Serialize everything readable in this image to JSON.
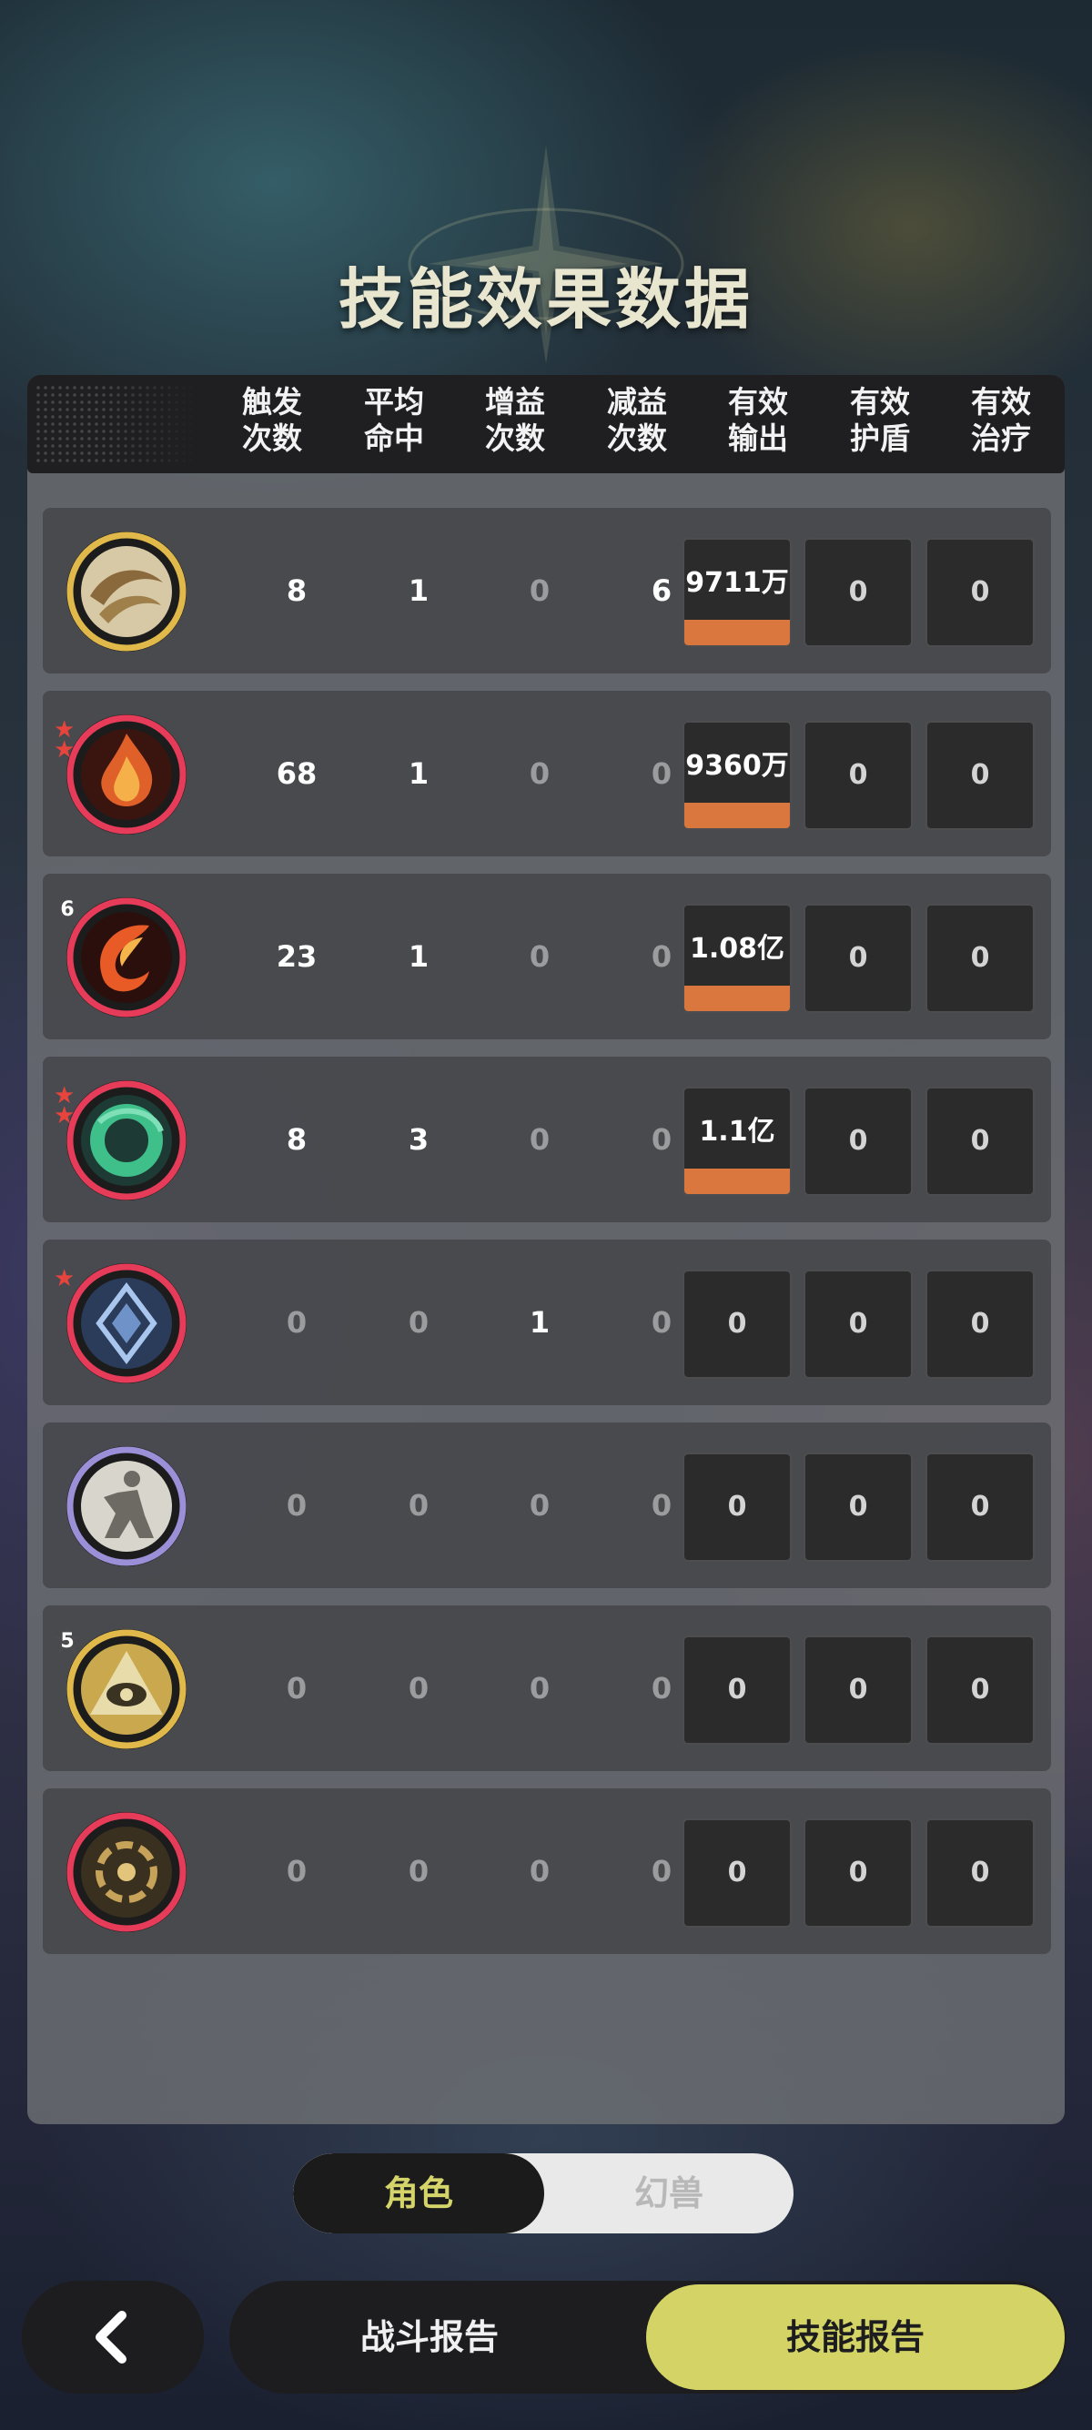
{
  "title": "技能效果数据",
  "columns": [
    {
      "line1": "触发",
      "line2": "次数"
    },
    {
      "line1": "平均",
      "line2": "命中"
    },
    {
      "line1": "增益",
      "line2": "次数"
    },
    {
      "line1": "减益",
      "line2": "次数"
    },
    {
      "line1": "有效",
      "line2": "输出"
    },
    {
      "line1": "有效",
      "line2": "护盾"
    },
    {
      "line1": "有效",
      "line2": "治疗"
    }
  ],
  "rows": [
    {
      "icon": "golden-wind-skill-icon",
      "ring": "#e0b94a",
      "badge": "",
      "trigger": "8",
      "avg_hit": "1",
      "buff": "0",
      "debuff": "6",
      "output": "9711万",
      "shield": "0",
      "heal": "0"
    },
    {
      "icon": "fire-burst-skill-icon",
      "ring": "#e63c5a",
      "badge": "stars-2",
      "trigger": "68",
      "avg_hit": "1",
      "buff": "0",
      "debuff": "0",
      "output": "9360万",
      "shield": "0",
      "heal": "0"
    },
    {
      "icon": "fire-swirl-skill-icon",
      "ring": "#e63c5a",
      "badge": "6",
      "trigger": "23",
      "avg_hit": "1",
      "buff": "0",
      "debuff": "0",
      "output": "1.08亿",
      "shield": "0",
      "heal": "0"
    },
    {
      "icon": "jade-ring-skill-icon",
      "ring": "#e63c5a",
      "badge": "stars-2",
      "trigger": "8",
      "avg_hit": "3",
      "buff": "0",
      "debuff": "0",
      "output": "1.1亿",
      "shield": "0",
      "heal": "0"
    },
    {
      "icon": "blue-sigil-skill-icon",
      "ring": "#e63c5a",
      "badge": "stars-1",
      "trigger": "0",
      "avg_hit": "0",
      "buff": "1",
      "debuff": "0",
      "output": "0",
      "shield": "0",
      "heal": "0"
    },
    {
      "icon": "shadow-figure-skill-icon",
      "ring": "#9b8fd8",
      "badge": "",
      "trigger": "0",
      "avg_hit": "0",
      "buff": "0",
      "debuff": "0",
      "output": "0",
      "shield": "0",
      "heal": "0"
    },
    {
      "icon": "eye-pyramid-skill-icon",
      "ring": "#e0b94a",
      "badge": "5",
      "trigger": "0",
      "avg_hit": "0",
      "buff": "0",
      "debuff": "0",
      "output": "0",
      "shield": "0",
      "heal": "0"
    },
    {
      "icon": "golden-vortex-skill-icon",
      "ring": "#e63c5a",
      "badge": "",
      "trigger": "0",
      "avg_hit": "0",
      "buff": "0",
      "debuff": "0",
      "output": "0",
      "shield": "0",
      "heal": "0"
    }
  ],
  "toggle": {
    "active": "角色",
    "inactive": "幻兽"
  },
  "nav": {
    "back_icon": "chevron-left-icon",
    "battle_report": "战斗报告",
    "skill_report": "技能报告"
  },
  "colors": {
    "accent": "#d3d465",
    "output_bar": "#d9773e"
  }
}
